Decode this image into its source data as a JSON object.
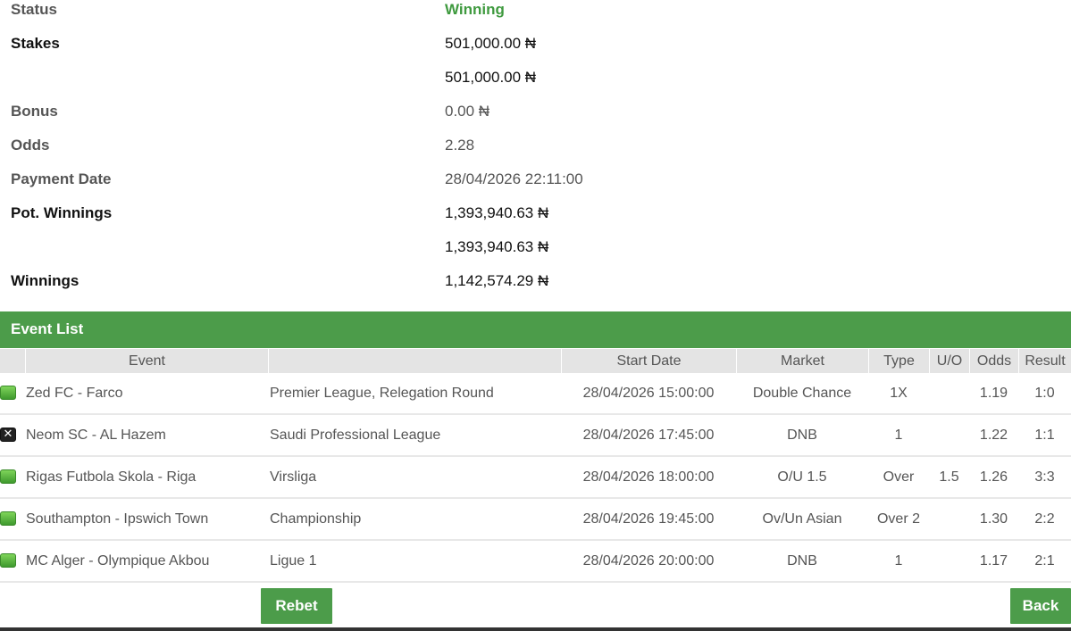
{
  "summary": {
    "status_label": "Status",
    "status_value": "Winning",
    "stakes_label": "Stakes",
    "stakes_value": "501,000.00 ₦",
    "stakes_value_2": "501,000.00 ₦",
    "bonus_label": "Bonus",
    "bonus_value": "0.00 ₦",
    "odds_label": "Odds",
    "odds_value": "2.28",
    "payment_date_label": "Payment Date",
    "payment_date_value": "28/04/2026 22:11:00",
    "pot_winnings_label": "Pot. Winnings",
    "pot_winnings_value": "1,393,940.63 ₦",
    "pot_winnings_value_2": "1,393,940.63 ₦",
    "winnings_label": "Winnings",
    "winnings_value": "1,142,574.29 ₦"
  },
  "event_list": {
    "title": "Event List",
    "columns": {
      "event": "Event",
      "league": "",
      "start_date": "Start Date",
      "market": "Market",
      "type": "Type",
      "uo": "U/O",
      "odds": "Odds",
      "result": "Result"
    },
    "rows": [
      {
        "status": "won",
        "event": "Zed FC - Farco",
        "league": "Premier League, Relegation Round",
        "start_date": "28/04/2026 15:00:00",
        "market": "Double Chance",
        "type": "1X",
        "uo": "",
        "odds": "1.19",
        "result": "1:0"
      },
      {
        "status": "lost",
        "event": "Neom SC - AL Hazem",
        "league": "Saudi Professional League",
        "start_date": "28/04/2026 17:45:00",
        "market": "DNB",
        "type": "1",
        "uo": "",
        "odds": "1.22",
        "result": "1:1"
      },
      {
        "status": "won",
        "event": "Rigas Futbola Skola - Riga",
        "league": "Virsliga",
        "start_date": "28/04/2026 18:00:00",
        "market": "O/U 1.5",
        "type": "Over",
        "uo": "1.5",
        "odds": "1.26",
        "result": "3:3"
      },
      {
        "status": "won",
        "event": "Southampton - Ipswich Town",
        "league": "Championship",
        "start_date": "28/04/2026 19:45:00",
        "market": "Ov/Un Asian",
        "type": "Over 2",
        "uo": "",
        "odds": "1.30",
        "result": "2:2"
      },
      {
        "status": "won",
        "event": "MC Alger - Olympique Akbou",
        "league": "Ligue 1",
        "start_date": "28/04/2026 20:00:00",
        "market": "DNB",
        "type": "1",
        "uo": "",
        "odds": "1.17",
        "result": "2:1"
      }
    ]
  },
  "buttons": {
    "rebet": "Rebet",
    "back": "Back"
  },
  "colors": {
    "accent": "#4c9c4a",
    "winning": "#3f9a3f"
  },
  "icons": {
    "won": "green-square-icon",
    "lost": "x-mark-icon"
  }
}
